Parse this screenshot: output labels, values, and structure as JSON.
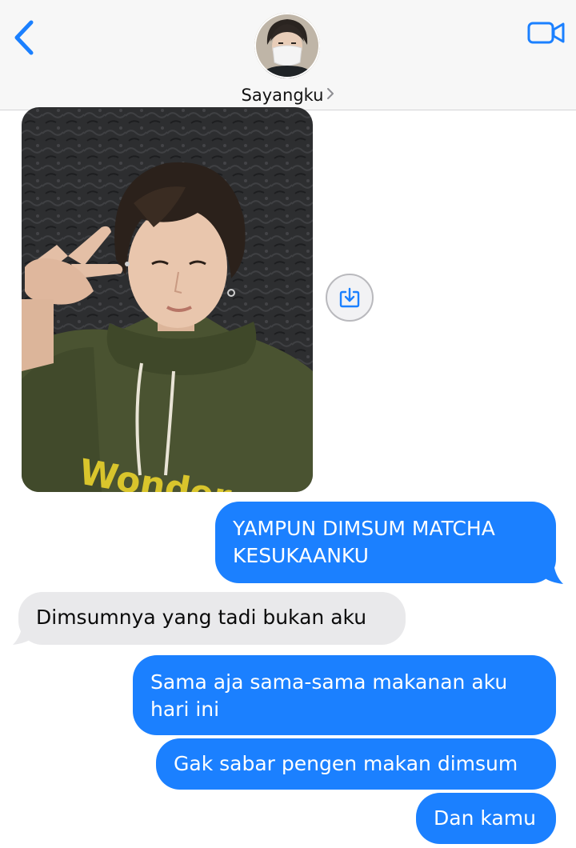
{
  "header": {
    "contact_name": "Sayangku",
    "back_icon": "chevron-left-icon",
    "video_icon": "video-camera-icon",
    "accent_color": "#1b80ff"
  },
  "messages": [
    {
      "direction": "outgoing",
      "text": "YAMPUN DIMSUM MATCHA\nKESUKAANKU"
    },
    {
      "direction": "incoming",
      "text": "Dimsumnya yang tadi bukan aku"
    },
    {
      "direction": "outgoing",
      "text": "Sama aja sama-sama makanan aku\nhari ini"
    },
    {
      "direction": "outgoing",
      "text": "Gak sabar pengen makan dimsum"
    },
    {
      "direction": "outgoing",
      "text": "Dan kamu"
    }
  ],
  "colors": {
    "outgoing_bubble": "#1b80ff",
    "incoming_bubble": "#e9e9eb"
  }
}
